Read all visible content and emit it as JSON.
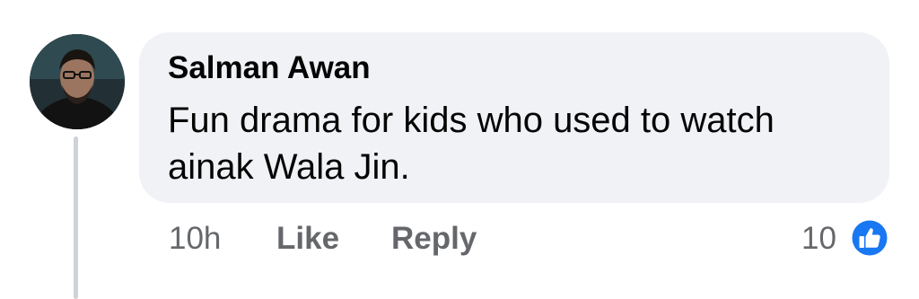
{
  "comment": {
    "author": "Salman Awan",
    "text": "Fun drama for kids who used to watch ainak Wala Jin.",
    "timestamp": "10h",
    "like_label": "Like",
    "reply_label": "Reply",
    "reaction_count": "10",
    "reaction_icon": "thumbs-up-icon"
  },
  "colors": {
    "bubble": "#f0f2f5",
    "text": "#050505",
    "secondary": "#65676b",
    "like_blue": "#1877f2",
    "thread_line": "#cfd2d6"
  }
}
